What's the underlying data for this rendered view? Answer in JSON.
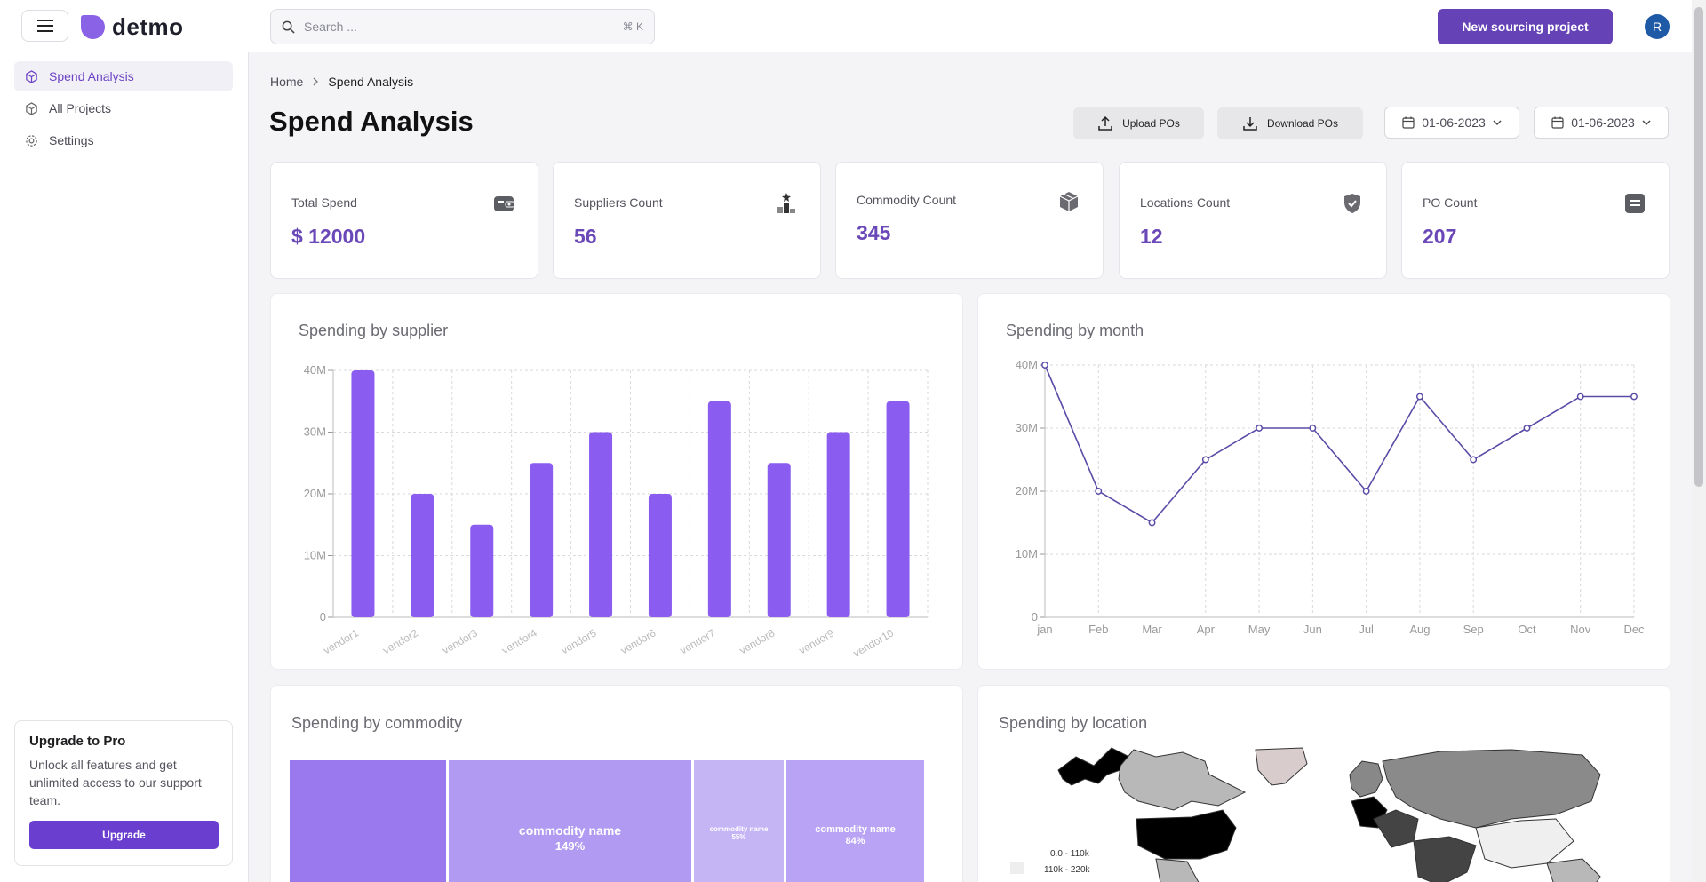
{
  "header": {
    "logo_text": "detmo",
    "search_placeholder": "Search ...",
    "search_shortcut": "⌘ K",
    "cta_label": "New sourcing project",
    "avatar_initial": "R"
  },
  "sidebar": {
    "items": [
      {
        "label": "Spend Analysis",
        "icon": "cube-icon",
        "active": true
      },
      {
        "label": "All Projects",
        "icon": "cube-icon",
        "active": false
      },
      {
        "label": "Settings",
        "icon": "gear-icon",
        "active": false
      }
    ],
    "upgrade": {
      "title": "Upgrade to Pro",
      "text": "Unlock all features and get unlimited access to our support team.",
      "button_label": "Upgrade"
    }
  },
  "breadcrumb": {
    "home": "Home",
    "current": "Spend Analysis"
  },
  "page": {
    "title": "Spend Analysis",
    "upload_label": "Upload POs",
    "download_label": "Download POs",
    "date_from": "01-06-2023",
    "date_to": "01-06-2023"
  },
  "stats": [
    {
      "label": "Total Spend",
      "value": "$ 12000",
      "icon": "wallet-icon"
    },
    {
      "label": "Suppliers Count",
      "value": "56",
      "icon": "podium-icon"
    },
    {
      "label": "Commodity Count",
      "value": "345",
      "icon": "box-icon"
    },
    {
      "label": "Locations Count",
      "value": "12",
      "icon": "shield-check-icon"
    },
    {
      "label": "PO Count",
      "value": "207",
      "icon": "list-icon"
    }
  ],
  "colors": {
    "accent": "#6543b6",
    "bar": "#8a5cf0",
    "line": "#5a4ba6",
    "value": "#6a48b8"
  },
  "chart_data": [
    {
      "type": "bar",
      "title": "Spending by supplier",
      "categories": [
        "vendor1",
        "vendor2",
        "vendor3",
        "vendor4",
        "vendor5",
        "vendor6",
        "vendor7",
        "vendor8",
        "vendor9",
        "vendor10"
      ],
      "values": [
        40,
        20,
        15,
        25,
        30,
        20,
        35,
        25,
        30,
        35
      ],
      "ytick_labels": [
        "0",
        "10M",
        "20M",
        "30M",
        "40M"
      ],
      "ylim": [
        0,
        40
      ],
      "grid": true
    },
    {
      "type": "line",
      "title": "Spending by month",
      "categories": [
        "jan",
        "Feb",
        "Mar",
        "Apr",
        "May",
        "Jun",
        "Jul",
        "Aug",
        "Sep",
        "Oct",
        "Nov",
        "Dec"
      ],
      "values": [
        40,
        20,
        15,
        25,
        30,
        30,
        20,
        35,
        25,
        30,
        35,
        35
      ],
      "ytick_labels": [
        "0",
        "10M",
        "20M",
        "30M",
        "40M"
      ],
      "ylim": [
        0,
        40
      ],
      "grid": true
    }
  ],
  "commodity": {
    "title": "Spending by commodity",
    "tiles": [
      {
        "name": "",
        "pct": ""
      },
      {
        "name": "commodity name",
        "pct": "149%"
      },
      {
        "name": "commodity name",
        "pct": "55%"
      },
      {
        "name": "commodity name",
        "pct": "84%"
      }
    ]
  },
  "location": {
    "title": "Spending by location",
    "legend": [
      "0.0 - 110k",
      "110k - 220k"
    ]
  }
}
